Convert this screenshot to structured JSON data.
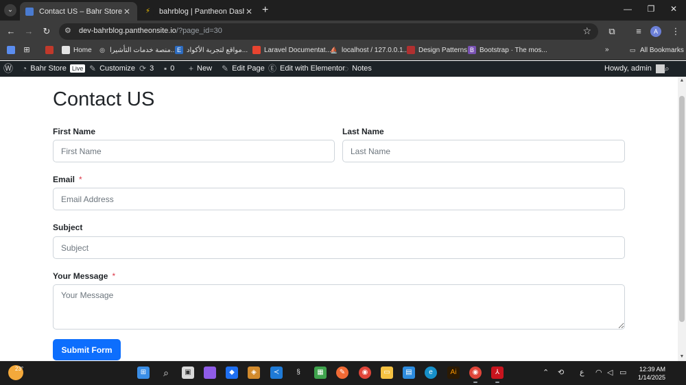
{
  "browser": {
    "tabs": [
      {
        "title": "Contact US – Bahr Store",
        "active": true
      },
      {
        "title": "bahrblog | Pantheon Dashboard",
        "active": false
      }
    ],
    "url_host": "dev-bahrblog.pantheonsite.io",
    "url_rest": "/?page_id=30",
    "profile_initial": "A"
  },
  "bookmarks": {
    "items": [
      "Home",
      "منصة خدمات التأشيرا...",
      "مواقع لتجربة الأكواد...",
      "Laravel Documentat...",
      "localhost / 127.0.0.1...",
      "Design Patterns",
      "Bootstrap · The mos..."
    ],
    "all_label": "All Bookmarks"
  },
  "wpbar": {
    "site": "Bahr Store",
    "live": "Live",
    "customize": "Customize",
    "updates": "3",
    "comments": "0",
    "new": "New",
    "edit_page": "Edit Page",
    "elementor": "Edit with Elementor",
    "notes": "Notes",
    "howdy": "Howdy, admin"
  },
  "form": {
    "title": "Contact US",
    "first_name_label": "First Name",
    "first_name_placeholder": "First Name",
    "last_name_label": "Last Name",
    "last_name_placeholder": "Last Name",
    "email_label": "Email",
    "email_placeholder": "Email Address",
    "subject_label": "Subject",
    "subject_placeholder": "Subject",
    "message_label": "Your Message",
    "message_placeholder": "Your Message",
    "required_mark": "*",
    "submit_label": "Submit Form"
  },
  "taskbar": {
    "temperature": "23°",
    "time": "12:39 AM",
    "date": "1/14/2025",
    "lang": "ع"
  },
  "colors": {
    "primary_button": "#0d6efd",
    "required": "#dc3545",
    "wp_admin_bar": "#1d2327",
    "browser_chrome": "#3c3c3c"
  }
}
